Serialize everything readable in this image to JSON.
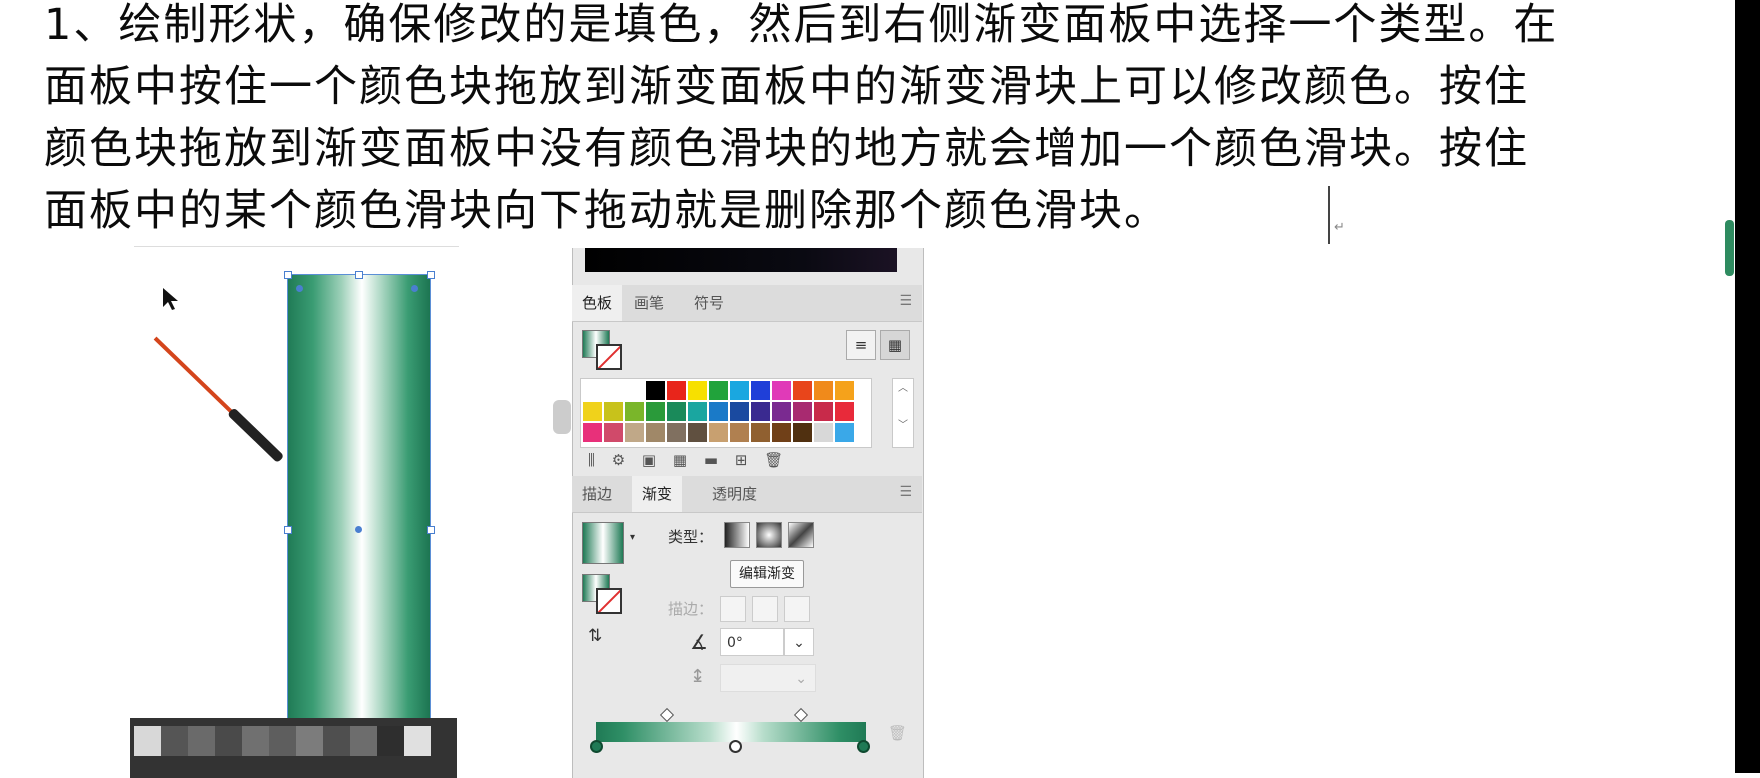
{
  "document": {
    "lines": [
      "1、绘制形状，确保修改的是填色，然后到右侧渐变面板中选择一个类型。在",
      "面板中按住一个颜色块拖放到渐变面板中的渐变滑块上可以修改颜色。按住",
      "颜色块拖放到渐变面板中没有颜色滑块的地方就会增加一个颜色滑块。按住",
      "面板中的某个颜色滑块向下拖动就是删除那个颜色滑块。"
    ],
    "paragraph_mark": "↵"
  },
  "swatches_panel": {
    "tabs": [
      "色板",
      "画笔",
      "符号"
    ],
    "active_tab": "色板",
    "menu_icon": "menu-icon",
    "colors": [
      [
        "#ffffff",
        "#ffffff",
        "#ffffff",
        "#000000",
        "#e8251b",
        "#f7e000",
        "#21a33b",
        "#1aa7e0",
        "#1f3fd8",
        "#e03ab8",
        "#e8451b",
        "#f08a1b",
        "#f5a21b"
      ],
      [
        "#f0d21b",
        "#c8c21b",
        "#7ab62a",
        "#2a9a3a",
        "#1a8a5a",
        "#1aa6a0",
        "#1a7ac8",
        "#1a4aa0",
        "#3a2a90",
        "#7a2a90",
        "#a82a70",
        "#c82a4a",
        "#e82a3a"
      ],
      [
        "#e8307a",
        "#d04a6a",
        "#c0a888",
        "#a08868",
        "#807060",
        "#605040",
        "#c8a070",
        "#b08050",
        "#906030",
        "#704018",
        "#503010",
        "#d8d8d8",
        "#3aa8e8"
      ]
    ]
  },
  "gradient_panel": {
    "tabs": [
      "描边",
      "渐变",
      "透明度"
    ],
    "active_tab": "渐变",
    "type_label": "类型：",
    "edit_button": "编辑渐变",
    "stroke_label": "描边：",
    "angle_value": "0°",
    "aspect_placeholder": ""
  }
}
